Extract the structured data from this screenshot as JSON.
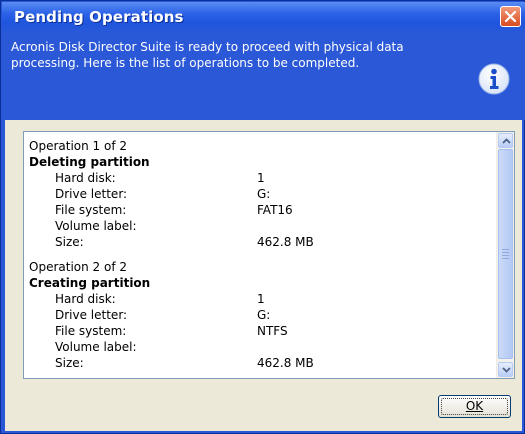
{
  "window": {
    "title": "Pending Operations"
  },
  "header": {
    "message": "Acronis Disk Director Suite is ready to proceed with physical data processing. Here is the list of operations to be completed.",
    "icon": "info-icon",
    "colors": {
      "band": "#2b58d6",
      "title_bar": "#2d63e8"
    }
  },
  "operations": [
    {
      "counter": "Operation 1 of 2",
      "title": "Deleting partition",
      "fields": [
        {
          "label": "Hard disk:",
          "value": "1"
        },
        {
          "label": "Drive letter:",
          "value": "G:"
        },
        {
          "label": "File system:",
          "value": "FAT16"
        },
        {
          "label": "Volume label:",
          "value": ""
        },
        {
          "label": "Size:",
          "value": "462.8 MB"
        }
      ]
    },
    {
      "counter": "Operation 2 of 2",
      "title": "Creating partition",
      "fields": [
        {
          "label": "Hard disk:",
          "value": "1"
        },
        {
          "label": "Drive letter:",
          "value": "G:"
        },
        {
          "label": "File system:",
          "value": "NTFS"
        },
        {
          "label": "Volume label:",
          "value": ""
        },
        {
          "label": "Size:",
          "value": "462.8 MB"
        }
      ]
    }
  ],
  "buttons": {
    "ok_label": "OK"
  }
}
